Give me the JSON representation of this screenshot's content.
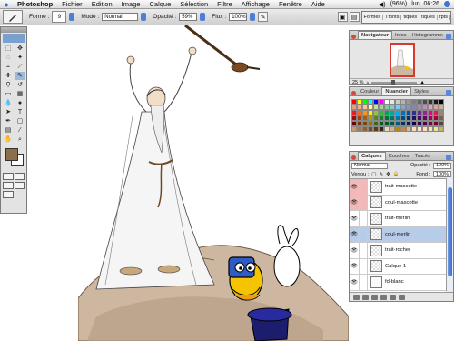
{
  "menubar": {
    "app": "Photoshop",
    "items": [
      "Fichier",
      "Edition",
      "Image",
      "Calque",
      "Sélection",
      "Filtre",
      "Affichage",
      "Fenêtre",
      "Aide"
    ],
    "battery": "(96%)",
    "clock": "lun. 06:26"
  },
  "options": {
    "forme_label": "Forme :",
    "brush_size": "9",
    "mode_label": "Mode :",
    "mode_value": "Normal",
    "opacity_label": "Opacité :",
    "opacity_value": "59%",
    "flux_label": "Flux :",
    "flux_value": "100%",
    "wells": [
      "Formes",
      "Tfonts",
      "tiques",
      "tiques",
      "rpts"
    ]
  },
  "navigator": {
    "tabs": [
      "Navigateur",
      "Infos",
      "Histogramme"
    ],
    "zoom": "25 %"
  },
  "swatches": {
    "tabs": [
      "Couleur",
      "Nuancier",
      "Styles"
    ],
    "colors": [
      "#ff0000",
      "#ffff00",
      "#00ff00",
      "#00ffff",
      "#0000ff",
      "#ff00ff",
      "#ffffff",
      "#e6e6e6",
      "#cccccc",
      "#b3b3b3",
      "#999999",
      "#808080",
      "#666666",
      "#4d4d4d",
      "#333333",
      "#1a1a1a",
      "#000000",
      "#f7977a",
      "#f9ad81",
      "#fdc68a",
      "#fff79a",
      "#c4df9b",
      "#a3d39c",
      "#82ca9d",
      "#7bcdc8",
      "#6ecff6",
      "#7ea7d8",
      "#8493ca",
      "#8882be",
      "#a187be",
      "#bc8dbf",
      "#f49ac2",
      "#f6989d",
      "#c7b299",
      "#ed1c24",
      "#f26522",
      "#f7941d",
      "#fff200",
      "#8dc73f",
      "#39b54a",
      "#00a651",
      "#00a99d",
      "#00aeef",
      "#0072bc",
      "#0054a6",
      "#2e3192",
      "#662d91",
      "#92278f",
      "#ec008c",
      "#ed145b",
      "#998675",
      "#9e0b0f",
      "#a0410d",
      "#a36209",
      "#aba000",
      "#598527",
      "#1a7b30",
      "#007236",
      "#00746b",
      "#0076a3",
      "#004b80",
      "#003471",
      "#1b1464",
      "#440e62",
      "#630460",
      "#9e005d",
      "#9e0039",
      "#736357",
      "#790000",
      "#7b2e00",
      "#7d4900",
      "#827b00",
      "#406618",
      "#005e20",
      "#005826",
      "#005952",
      "#005b7f",
      "#003663",
      "#002157",
      "#0d004c",
      "#32004b",
      "#4b0049",
      "#7b0046",
      "#7a0026",
      "#534741",
      "#c69c6d",
      "#a67c52",
      "#8c6239",
      "#754c24",
      "#603913",
      "#3c2415",
      "#e8d7c0",
      "#d2b48c",
      "#b8860b",
      "#cd853f",
      "#deb887",
      "#f5deb3",
      "#ffe4c4",
      "#ffdab9",
      "#eee8aa",
      "#f0e68c",
      "#bdb76b"
    ]
  },
  "layers": {
    "tabs": [
      "Calques",
      "Couches",
      "Tracés"
    ],
    "blend_mode": "Normal",
    "opacity_label": "Opacité :",
    "opacity_value": "100%",
    "lock_label": "Verrou :",
    "fill_label": "Fond :",
    "fill_value": "100%",
    "rows": [
      {
        "name": "trait-mascotte",
        "flag": "red"
      },
      {
        "name": "coul-mascotte",
        "flag": "red"
      },
      {
        "name": "trait-merlin",
        "flag": "none"
      },
      {
        "name": "coul-merlin",
        "flag": "selected"
      },
      {
        "name": "trait-rocher",
        "flag": "none"
      },
      {
        "name": "Calque 1",
        "flag": "none"
      },
      {
        "name": "fd-blanc",
        "flag": "plain"
      }
    ]
  },
  "colors": {
    "foreground": "#8a6f4a",
    "background": "#ffffff",
    "accent": "#3c6fcf"
  }
}
